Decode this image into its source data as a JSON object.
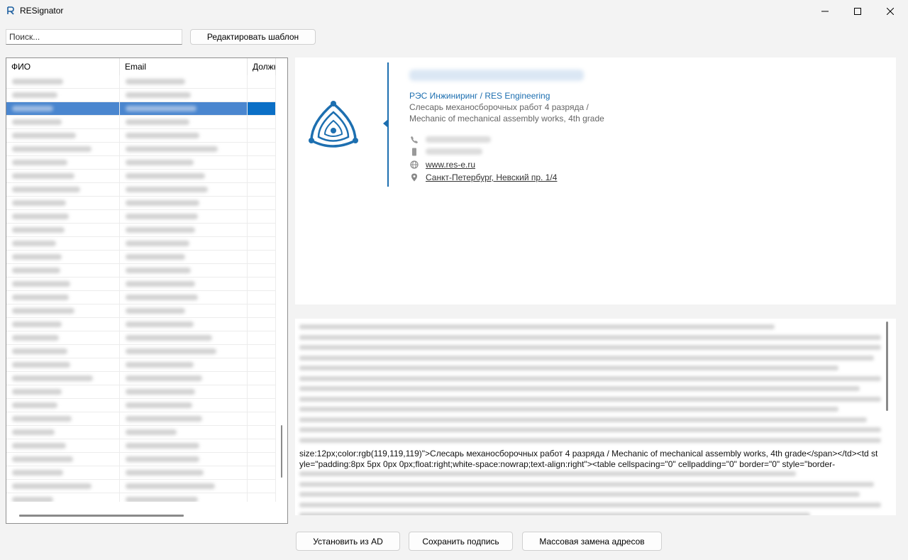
{
  "window": {
    "title": "RESignator"
  },
  "toolbar": {
    "search_placeholder": "Поиск...",
    "edit_template_label": "Редактировать шаблон"
  },
  "grid": {
    "columns": [
      "ФИО",
      "Email",
      "Должн"
    ],
    "selected_row_index": 2
  },
  "signature": {
    "company": "РЭС Инжиниринг / RES Engineering",
    "position_ru": "Слесарь механосборочных работ 4 разряда /",
    "position_en": "Mechanic of mechanical assembly works, 4th grade",
    "website": "www.res-e.ru",
    "address": "Санкт-Петербург, Невский пр. 1/4",
    "accent_color": "#1d6fb0",
    "icons": [
      "phone-icon",
      "mobile-phone-icon",
      "globe-icon",
      "location-pin-icon"
    ]
  },
  "html_source": {
    "visible_text": "size:12px;color:rgb(119,119,119)\">Слесарь механосборочных работ 4 разряда / Mechanic of mechanical assembly works, 4th grade</span></td><td style=\"padding:8px 5px 0px 0px;float:right;white-space:nowrap;text-align:right\"><table cellspacing=\"0\" cellpadding=\"0\" border=\"0\" style=\"border-"
  },
  "footer": {
    "install_ad_label": "Установить из AD",
    "save_label": "Сохранить подпись",
    "mass_replace_label": "Массовая замена адресов"
  }
}
